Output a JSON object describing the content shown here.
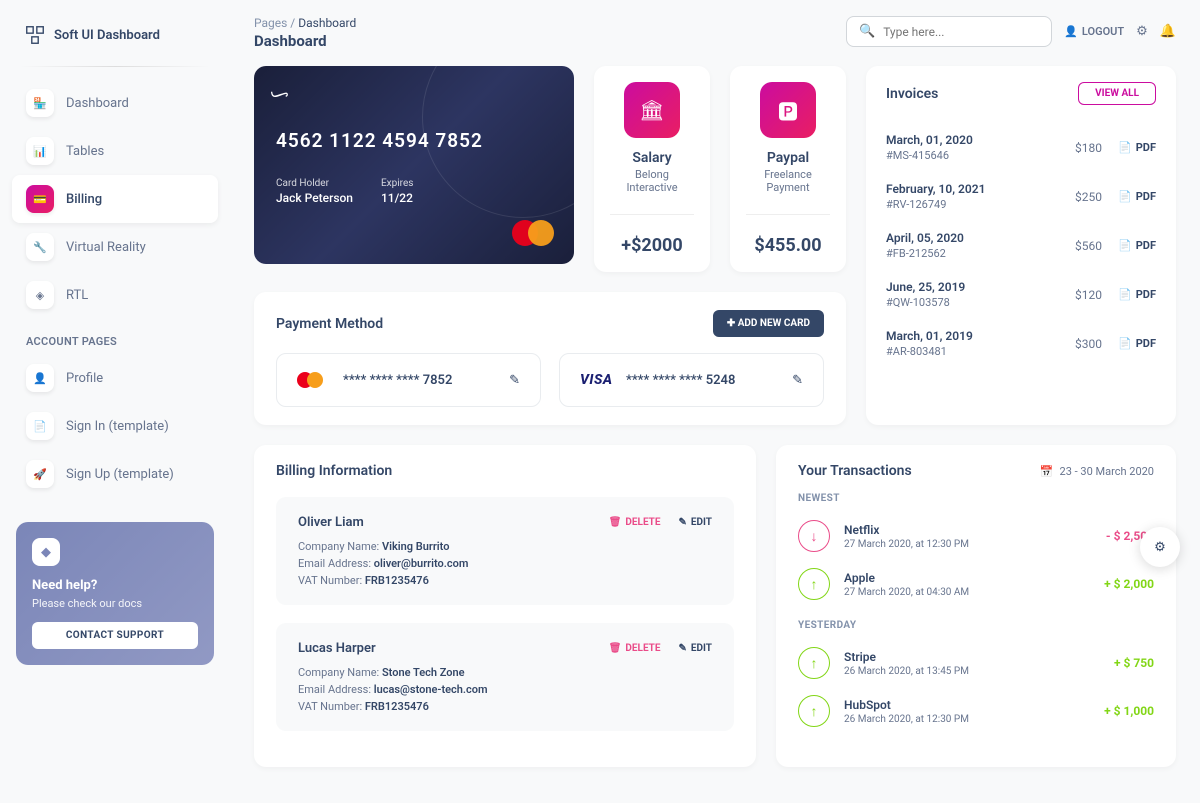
{
  "brand": "Soft UI Dashboard",
  "nav": [
    {
      "label": "Dashboard",
      "icon": "▦"
    },
    {
      "label": "Tables",
      "icon": "📊"
    },
    {
      "label": "Billing",
      "icon": "💳"
    },
    {
      "label": "Virtual Reality",
      "icon": "🔧"
    },
    {
      "label": "RTL",
      "icon": "◈"
    }
  ],
  "nav_section": "ACCOUNT PAGES",
  "nav2": [
    {
      "label": "Profile",
      "icon": "👤"
    },
    {
      "label": "Sign In (template)",
      "icon": "📄"
    },
    {
      "label": "Sign Up (template)",
      "icon": "🚀"
    }
  ],
  "help": {
    "title": "Need help?",
    "sub": "Please check our docs",
    "btn": "CONTACT SUPPORT"
  },
  "breadcrumb": {
    "root": "Pages",
    "current": "Dashboard",
    "title": "Dashboard"
  },
  "search": {
    "placeholder": "Type here..."
  },
  "logout": "LOGOUT",
  "creditcard": {
    "number": "4562   1122   4594   7852",
    "holder_lbl": "Card Holder",
    "holder": "Jack Peterson",
    "exp_lbl": "Expires",
    "exp": "11/22"
  },
  "stats": [
    {
      "title": "Salary",
      "sub": "Belong Interactive",
      "value": "+$2000",
      "icon": "bank"
    },
    {
      "title": "Paypal",
      "sub": "Freelance Payment",
      "value": "$455.00",
      "icon": "paypal"
    }
  ],
  "invoices": {
    "title": "Invoices",
    "viewall": "VIEW ALL",
    "items": [
      {
        "date": "March, 01, 2020",
        "id": "#MS-415646",
        "amt": "$180",
        "pdf": "PDF"
      },
      {
        "date": "February, 10, 2021",
        "id": "#RV-126749",
        "amt": "$250",
        "pdf": "PDF"
      },
      {
        "date": "April, 05, 2020",
        "id": "#FB-212562",
        "amt": "$560",
        "pdf": "PDF"
      },
      {
        "date": "June, 25, 2019",
        "id": "#QW-103578",
        "amt": "$120",
        "pdf": "PDF"
      },
      {
        "date": "March, 01, 2019",
        "id": "#AR-803481",
        "amt": "$300",
        "pdf": "PDF"
      }
    ]
  },
  "payment": {
    "title": "Payment Method",
    "add": "ADD NEW CARD",
    "cards": [
      {
        "brand": "mastercard",
        "masked": "****   ****   ****   7852"
      },
      {
        "brand": "visa",
        "masked": "****   ****   ****   5248"
      }
    ]
  },
  "billing": {
    "title": "Billing Information",
    "delete": "DELETE",
    "edit": "EDIT",
    "company_lbl": "Company Name:",
    "email_lbl": "Email Address:",
    "vat_lbl": "VAT Number:",
    "items": [
      {
        "name": "Oliver Liam",
        "company": "Viking Burrito",
        "email": "oliver@burrito.com",
        "vat": "FRB1235476"
      },
      {
        "name": "Lucas Harper",
        "company": "Stone Tech Zone",
        "email": "lucas@stone-tech.com",
        "vat": "FRB1235476"
      }
    ]
  },
  "trans": {
    "title": "Your Transactions",
    "range": "23 - 30 March 2020",
    "newest": "NEWEST",
    "yesterday": "YESTERDAY",
    "items_newest": [
      {
        "name": "Netflix",
        "time": "27 March 2020, at 12:30 PM",
        "amt": "- $ 2,500",
        "dir": "down"
      },
      {
        "name": "Apple",
        "time": "27 March 2020, at 04:30 AM",
        "amt": "+ $ 2,000",
        "dir": "up"
      }
    ],
    "items_yesterday": [
      {
        "name": "Stripe",
        "time": "26 March 2020, at 13:45 PM",
        "amt": "+ $ 750",
        "dir": "up"
      },
      {
        "name": "HubSpot",
        "time": "26 March 2020, at 12:30 PM",
        "amt": "+ $ 1,000",
        "dir": "up"
      }
    ]
  }
}
